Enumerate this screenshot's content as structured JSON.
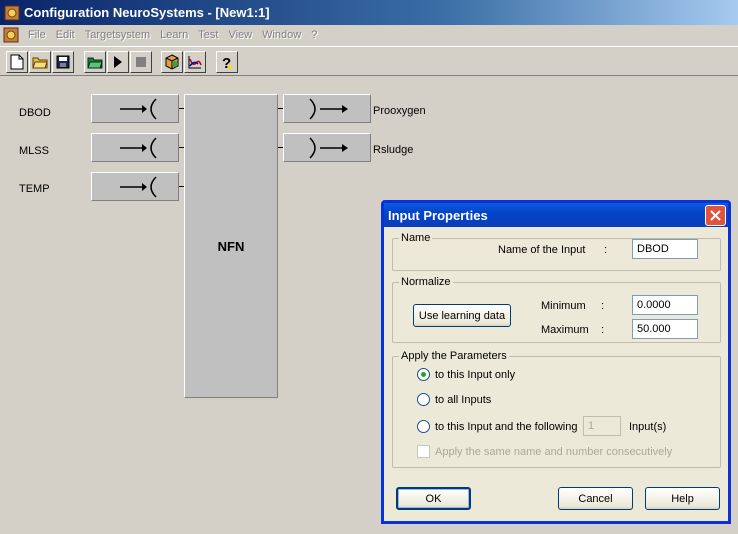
{
  "window": {
    "title": "Configuration NeuroSystems - [New1:1]"
  },
  "menu": [
    "File",
    "Edit",
    "Targetsystem",
    "Learn",
    "Test",
    "View",
    "Window",
    "?"
  ],
  "toolbar": [
    "new",
    "open",
    "save",
    "open-project",
    "run",
    "stop",
    "model",
    "chart",
    "help"
  ],
  "inputs": [
    "DBOD",
    "MLSS",
    "TEMP"
  ],
  "outputs": [
    "Prooxygen",
    "Rsludge"
  ],
  "block": {
    "label": "NFN"
  },
  "dialog": {
    "title": "Input Properties",
    "name_group": "Name",
    "name_label": "Name of the Input",
    "colon": ":",
    "name_value": "DBOD",
    "normalize_group": "Normalize",
    "use_learning_data": "Use learning data",
    "minimum_label": "Minimum",
    "minimum_value": "0.0000",
    "maximum_label": "Maximum",
    "maximum_value": "50.000",
    "apply_group": "Apply the Parameters",
    "opt_this_only": "to this Input only",
    "opt_all": "to all Inputs",
    "opt_following": "to this Input and the following",
    "following_count": "1",
    "following_suffix": "Input(s)",
    "same_name_check": "Apply the same name and number consecutively",
    "ok": "OK",
    "cancel": "Cancel",
    "help": "Help"
  },
  "colors": {
    "title_blue": "#0a246a",
    "dialog_border": "#0831d9",
    "close_red": "#e0533d"
  }
}
